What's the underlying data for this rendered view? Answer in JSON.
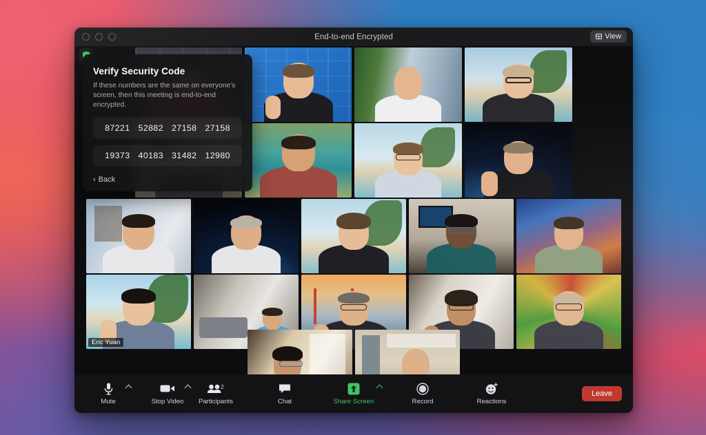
{
  "window": {
    "title": "End-to-end Encrypted",
    "view_button": {
      "label": "View",
      "icon": "grid-icon"
    },
    "traffic_lights": [
      "close",
      "minimize",
      "maximize"
    ],
    "encryption_shield_icon": "green-shield-icon"
  },
  "security_panel": {
    "title": "Verify Security Code",
    "description": "If these numbers are the same on everyone's screen, then this meeting is end-to-end encrypted.",
    "code_row_1": [
      "87221",
      "52882",
      "27158",
      "27158"
    ],
    "code_row_2": [
      "19373",
      "40183",
      "31482",
      "12980"
    ],
    "back_label": "Back",
    "back_chevron": "chevron-left-icon"
  },
  "toolbar": {
    "mute": {
      "label": "Mute",
      "icon": "microphone-icon",
      "has_caret": true
    },
    "stop_video": {
      "label": "Stop Video",
      "icon": "video-camera-icon",
      "has_caret": true
    },
    "participants": {
      "label": "Participants",
      "icon": "people-icon",
      "count": "2"
    },
    "chat": {
      "label": "Chat",
      "icon": "speech-bubble-icon"
    },
    "share_screen": {
      "label": "Share Screen",
      "icon": "share-arrow-up-icon",
      "has_caret": true,
      "color": "#45c065"
    },
    "record": {
      "label": "Record",
      "icon": "record-circle-icon"
    },
    "reactions": {
      "label": "Reactions",
      "icon": "smiley-plus-icon"
    },
    "leave": {
      "label": "Leave",
      "color": "#c0392f"
    }
  },
  "gallery": {
    "active_speaker_name": "Eric Yuan",
    "rows": [
      {
        "tiles": [
          {
            "name": "participant-1",
            "bg": "office-dark",
            "skin": "#d9a884",
            "shirt": "#b4453c",
            "hair": "#2b2218"
          },
          {
            "name": "participant-2",
            "bg": "zoom-blue",
            "skin": "#e6bb96",
            "shirt": "#1d1d21",
            "hair": "#6b523a"
          },
          {
            "name": "participant-3",
            "bg": "plants-city",
            "skin": "#e3b691",
            "shirt": "#efefef",
            "hair": "#1a1410"
          },
          {
            "name": "participant-4",
            "bg": "beach-palm",
            "skin": "#e8c09b",
            "shirt": "#2a2a2e",
            "hair": "#c8b18c"
          }
        ]
      },
      {
        "tiles": [
          {
            "name": "participant-5",
            "bg": "living-room",
            "skin": "#dfae86",
            "shirt": "#3a3a40",
            "hair": "#1c1713"
          },
          {
            "name": "participant-6",
            "bg": "lagoon",
            "skin": "#d7a175",
            "shirt": "#9c4a42",
            "hair": "#2a1f16"
          },
          {
            "name": "participant-7",
            "bg": "beach-palm2",
            "skin": "#e9c3a0",
            "shirt": "#cfd8e2",
            "hair": "#7a5c3d"
          },
          {
            "name": "participant-8",
            "bg": "space-earth",
            "skin": "#e2b089",
            "shirt": "#17171b",
            "hair": "#8a7photo"
          }
        ]
      },
      {
        "tiles": [
          {
            "name": "participant-9",
            "bg": "home-office",
            "skin": "#e0b188",
            "shirt": "#e8e8ea",
            "hair": "#241b12"
          },
          {
            "name": "participant-10",
            "bg": "space-earth2",
            "skin": "#ddae87",
            "shirt": "#e6e6e8",
            "hair": "#b9b2a6"
          },
          {
            "name": "participant-11",
            "bg": "beach-palm3",
            "skin": "#e7bd99",
            "shirt": "#1f1f24",
            "hair": "#5b4530"
          },
          {
            "name": "participant-12",
            "bg": "desk-monitor",
            "skin": "#6e4b33",
            "shirt": "#1d5b5e",
            "hair": "#141010"
          },
          {
            "name": "participant-13",
            "bg": "cosmic-art",
            "skin": "#e0b089",
            "shirt": "#8d9e7e",
            "hair": "#3a2c1e"
          }
        ]
      },
      {
        "tiles": [
          {
            "name": "participant-eric-yuan",
            "bg": "beach-palm4",
            "skin": "#e8c29c",
            "shirt": "#6f7f99",
            "hair": "#17120d",
            "speaking": true,
            "label": "Eric Yuan"
          },
          {
            "name": "participant-14",
            "bg": "modern-lounge",
            "skin": "#d8a87e",
            "shirt": "#4aa3e0",
            "hair": "#2d2218"
          },
          {
            "name": "participant-15",
            "bg": "golden-gate",
            "skin": "#dfb188",
            "shirt": "#26262b",
            "hair": "#6f6a62"
          },
          {
            "name": "participant-16",
            "bg": "white-room",
            "skin": "#c08f66",
            "shirt": "#3c3c44",
            "hair": "#2a2018"
          },
          {
            "name": "participant-17",
            "bg": "justice-art",
            "skin": "#e0b68e",
            "shirt": "#41414a",
            "hair": "#c9b79a"
          }
        ]
      },
      {
        "tiles": [
          {
            "name": "participant-18",
            "bg": "bookshelf",
            "skin": "#c9966c",
            "shirt": "#4f8f5a",
            "hair": "#17120c"
          },
          {
            "name": "participant-19",
            "bg": "open-office",
            "skin": "#dcb089",
            "shirt": "#18181c",
            "hair": "#1d1510"
          }
        ]
      }
    ]
  }
}
